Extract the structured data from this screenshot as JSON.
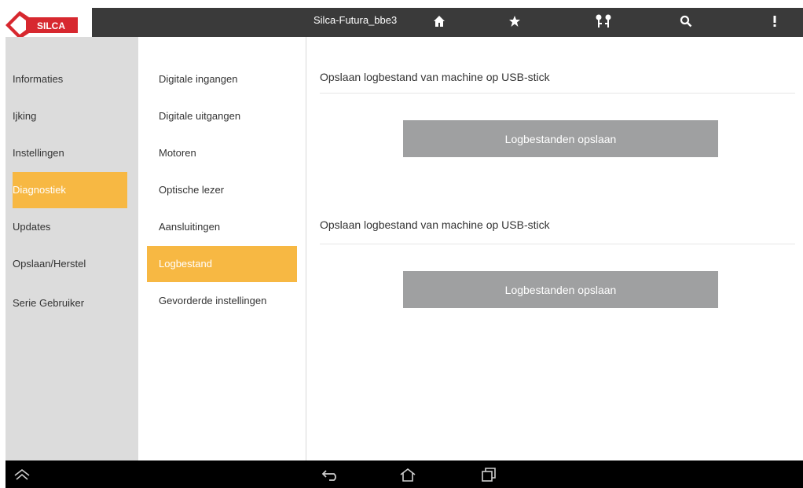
{
  "topbar": {
    "logo_text": "SILCA",
    "device_name": "Silca-Futura_bbe3",
    "icons": [
      "home-icon",
      "star-icon",
      "keys-icon",
      "search-icon",
      "more-vert-icon"
    ]
  },
  "sidebar": {
    "items": [
      {
        "label": "Informaties",
        "active": false
      },
      {
        "label": "Ijking",
        "active": false
      },
      {
        "label": "Instellingen",
        "active": false
      },
      {
        "label": "Diagnostiek",
        "active": true
      },
      {
        "label": "Updates",
        "active": false
      },
      {
        "label": "Opslaan/Herstel",
        "active": false
      },
      {
        "label": "Serie Gebruiker",
        "active": false
      }
    ]
  },
  "submenu": {
    "items": [
      {
        "label": "Digitale ingangen",
        "active": false
      },
      {
        "label": "Digitale uitgangen",
        "active": false
      },
      {
        "label": "Motoren",
        "active": false
      },
      {
        "label": "Optische lezer",
        "active": false
      },
      {
        "label": "Aansluitingen",
        "active": false
      },
      {
        "label": "Logbestand",
        "active": true
      },
      {
        "label": "Gevorderde instellingen",
        "active": false
      }
    ]
  },
  "content": {
    "sections": [
      {
        "title": "Opslaan logbestand van machine op USB-stick",
        "button_label": "Logbestanden opslaan"
      },
      {
        "title": "Opslaan logbestand van machine op USB-stick",
        "button_label": "Logbestanden opslaan"
      }
    ]
  },
  "navbar": {
    "icons": [
      "keyboard-hide-icon",
      "back-icon",
      "home-outline-icon",
      "recent-apps-icon"
    ]
  },
  "colors": {
    "accent": "#f7b843",
    "topbar": "#3a3a3a",
    "sidebar": "#dcdcdc",
    "button": "#9fa0a1",
    "logo_red": "#d7282f"
  }
}
